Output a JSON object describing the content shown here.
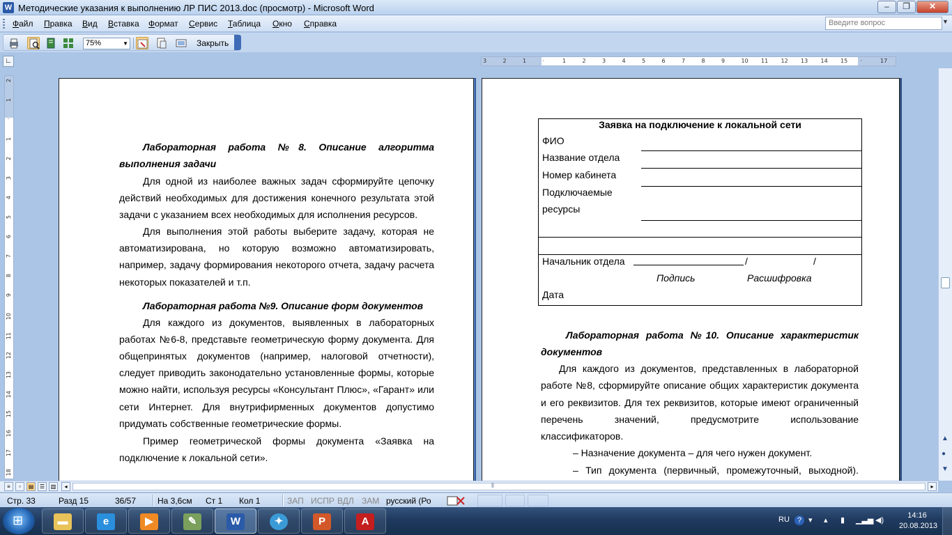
{
  "window": {
    "title": "Методические указания к выполнению ЛР ПИС 2013.doc (просмотр) - Microsoft Word",
    "app_icon": "W"
  },
  "menu": [
    "Файл",
    "Правка",
    "Вид",
    "Вставка",
    "Формат",
    "Сервис",
    "Таблица",
    "Окно",
    "Справка"
  ],
  "question_box": {
    "placeholder": "Введите вопрос"
  },
  "toolbar": {
    "zoom": "75%",
    "close_label": "Закрыть"
  },
  "ruler": {
    "h_ticks": [
      "3",
      "2",
      "1",
      "",
      "1",
      "2",
      "3",
      "4",
      "5",
      "6",
      "7",
      "8",
      "9",
      "10",
      "11",
      "12",
      "13",
      "14",
      "15",
      "",
      "17"
    ],
    "v_ticks": [
      "2",
      "1",
      "",
      "1",
      "2",
      "3",
      "4",
      "5",
      "6",
      "7",
      "8",
      "9",
      "10",
      "11",
      "12",
      "13",
      "14",
      "15",
      "16",
      "17",
      "18"
    ]
  },
  "left_page": {
    "h8": "Лабораторная работа №8. Описание алгоритма",
    "h8b": "выполнения задачи",
    "p1": [
      "Для одной из наиболее важных задач сформируйте цепочку",
      "действий необходимых для достижения конечного результата этой",
      "задачи с указанием всех необходимых для исполнения ресурсов."
    ],
    "p2": [
      "Для выполнения этой работы выберите задачу, которая не",
      "автоматизирована, но которую возможно автоматизировать,",
      "например, задачу формирования некоторого отчета, задачу расчета",
      "некоторых показателей и т.п."
    ],
    "h9": "Лабораторная работа №9. Описание форм документов",
    "p3": [
      "Для каждого из документов, выявленных в лабораторных",
      "работах №6-8, представьте геометрическую форму документа. Для",
      "общепринятых документов (например, налоговой отчетности),",
      "следует приводить законодательно установленные формы, которые",
      "можно найти, используя ресурсы «Консультант Плюс», «Гарант» или",
      "сети Интернет. Для внутрифирменных документов допустимо",
      "придумать собственные геометрические формы."
    ],
    "p4": [
      "Пример геометрической формы документа «Заявка на",
      "подключение к локальной сети»."
    ]
  },
  "form": {
    "title": "Заявка на подключение к локальной сети",
    "fio": "ФИО",
    "dept": "Название отдела",
    "room": "Номер кабинета",
    "res1": "Подключаемые",
    "res2": "ресурсы",
    "chief": "Начальник отдела",
    "slash1": "/",
    "slash2": "/",
    "sign": "Подпись",
    "decode": "Расшифровка",
    "date": "Дата"
  },
  "right_page": {
    "h10": "Лабораторная работа №10. Описание характеристик",
    "h10b": "документов",
    "p1": [
      "Для каждого из документов, представленных в лабораторной",
      "работе №8, сформируйте описание общих характеристик документа",
      "и его реквизитов. Для тех реквизитов, которые имеют ограниченный",
      "перечень значений, предусмотрите использование",
      "классификаторов."
    ],
    "b1": "–   Назначение документа – для чего нужен документ.",
    "b2": "–   Тип документа (первичный, промежуточный, выходной)."
  },
  "status": {
    "page": "Стр. 33",
    "section": "Разд 15",
    "pages": "36/57",
    "at": "На 3,6см",
    "line": "Ст 1",
    "col": "Кол 1",
    "rec": "ЗАП",
    "trk": "ИСПР",
    "ext": "ВДЛ",
    "ovr": "ЗАМ",
    "lang": "русский (Ро"
  },
  "taskbar": {
    "lang": "RU",
    "time": "14:16",
    "date": "20.08.2013"
  }
}
